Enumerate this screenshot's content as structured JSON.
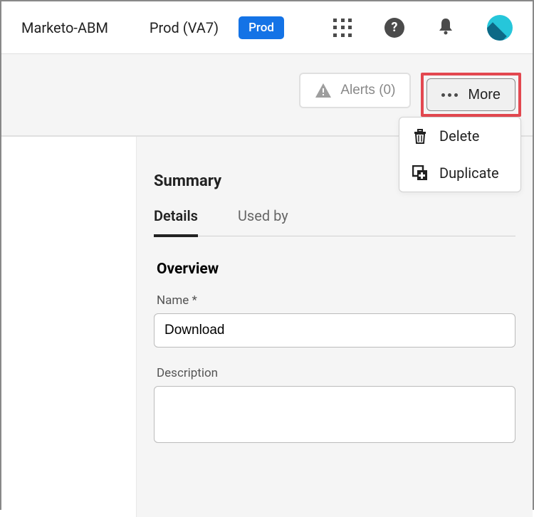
{
  "topbar": {
    "org": "Marketo-ABM",
    "env": "Prod (VA7)",
    "env_badge": "Prod"
  },
  "actions": {
    "alerts_label": "Alerts (0)",
    "more_label": "More"
  },
  "dropdown": {
    "items": [
      {
        "label": "Delete"
      },
      {
        "label": "Duplicate"
      }
    ]
  },
  "summary": {
    "title": "Summary",
    "tabs": [
      {
        "label": "Details"
      },
      {
        "label": "Used by"
      }
    ],
    "overview_title": "Overview",
    "name_label": "Name *",
    "name_value": "Download",
    "description_label": "Description",
    "description_value": ""
  }
}
